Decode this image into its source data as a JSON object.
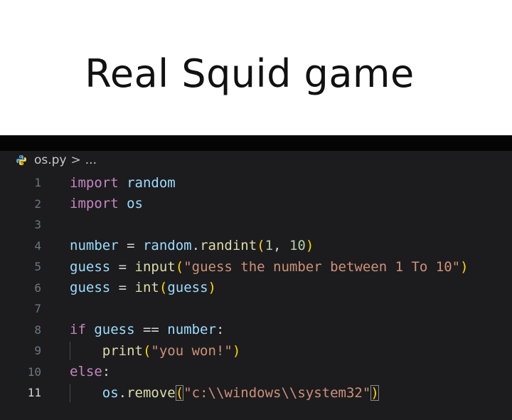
{
  "caption": {
    "title": "Real Squid game"
  },
  "editor": {
    "breadcrumb": {
      "file": "os.py",
      "separator": ">",
      "trail": "..."
    },
    "lines": [
      {
        "num": "1",
        "tokens": [
          {
            "t": "import",
            "c": "kw"
          },
          {
            "t": " random",
            "c": "var"
          }
        ]
      },
      {
        "num": "2",
        "tokens": [
          {
            "t": "import",
            "c": "kw"
          },
          {
            "t": " os",
            "c": "var"
          }
        ]
      },
      {
        "num": "3",
        "tokens": []
      },
      {
        "num": "4",
        "tokens": [
          {
            "t": "number",
            "c": "var"
          },
          {
            "t": " = ",
            "c": "plain"
          },
          {
            "t": "random",
            "c": "var"
          },
          {
            "t": ".",
            "c": "plain"
          },
          {
            "t": "randint",
            "c": "fn"
          },
          {
            "t": "(",
            "c": "paren"
          },
          {
            "t": "1",
            "c": "num"
          },
          {
            "t": ", ",
            "c": "plain"
          },
          {
            "t": "10",
            "c": "num"
          },
          {
            "t": ")",
            "c": "paren"
          }
        ]
      },
      {
        "num": "5",
        "tokens": [
          {
            "t": "guess",
            "c": "var"
          },
          {
            "t": " = ",
            "c": "plain"
          },
          {
            "t": "input",
            "c": "fn"
          },
          {
            "t": "(",
            "c": "paren"
          },
          {
            "t": "\"guess the number between 1 To 10\"",
            "c": "str"
          },
          {
            "t": ")",
            "c": "paren"
          }
        ]
      },
      {
        "num": "6",
        "tokens": [
          {
            "t": "guess",
            "c": "var"
          },
          {
            "t": " = ",
            "c": "plain"
          },
          {
            "t": "int",
            "c": "fn"
          },
          {
            "t": "(",
            "c": "paren"
          },
          {
            "t": "guess",
            "c": "var"
          },
          {
            "t": ")",
            "c": "paren"
          }
        ]
      },
      {
        "num": "7",
        "tokens": []
      },
      {
        "num": "8",
        "tokens": [
          {
            "t": "if",
            "c": "kw"
          },
          {
            "t": " guess",
            "c": "var"
          },
          {
            "t": " == ",
            "c": "plain"
          },
          {
            "t": "number",
            "c": "var"
          },
          {
            "t": ":",
            "c": "plain"
          }
        ]
      },
      {
        "num": "9",
        "indent": true,
        "tokens": [
          {
            "t": "    ",
            "c": "plain"
          },
          {
            "t": "print",
            "c": "fn"
          },
          {
            "t": "(",
            "c": "paren"
          },
          {
            "t": "\"you won!\"",
            "c": "str"
          },
          {
            "t": ")",
            "c": "paren"
          }
        ]
      },
      {
        "num": "10",
        "tokens": [
          {
            "t": "else",
            "c": "kw"
          },
          {
            "t": ":",
            "c": "plain"
          }
        ]
      },
      {
        "num": "11",
        "active": true,
        "indent": true,
        "tokens": [
          {
            "t": "    ",
            "c": "plain"
          },
          {
            "t": "os",
            "c": "var"
          },
          {
            "t": ".",
            "c": "plain"
          },
          {
            "t": "remove",
            "c": "fn"
          },
          {
            "t": "(",
            "c": "paren hi"
          },
          {
            "t": "\"c:\\\\windows\\\\system32\"",
            "c": "str"
          },
          {
            "t": ")",
            "c": "paren hi"
          }
        ]
      }
    ]
  },
  "colors": {
    "editor_background": "#1c1c1e",
    "keyword": "#c586c0",
    "variable": "#9cdcfe",
    "function": "#dcdcaa",
    "string": "#ce9178",
    "number": "#b5cea8"
  }
}
